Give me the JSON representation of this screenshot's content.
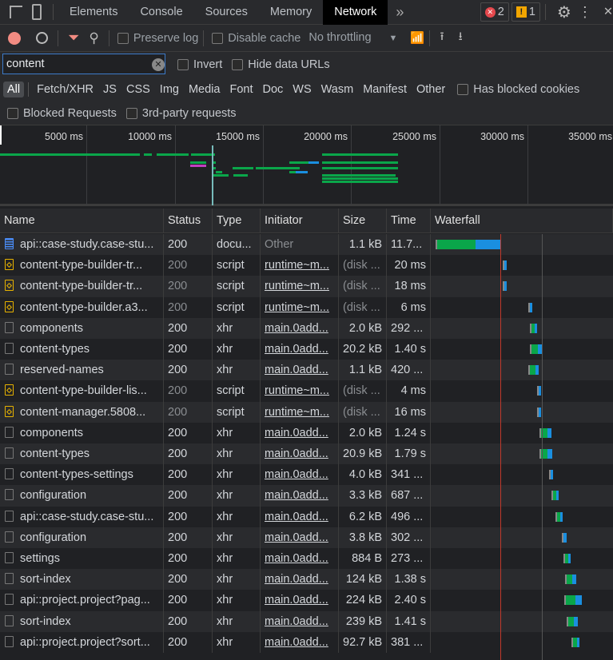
{
  "tabs": {
    "items": [
      "Elements",
      "Console",
      "Sources",
      "Memory",
      "Network"
    ],
    "active": "Network",
    "more": "»",
    "errors": "2",
    "warnings": "1"
  },
  "toolbar": {
    "preserve_log": "Preserve log",
    "disable_cache": "Disable cache",
    "throttling": "No throttling"
  },
  "filter": {
    "value": "content",
    "invert": "Invert",
    "hide_data_urls": "Hide data URLs"
  },
  "types": [
    "All",
    "Fetch/XHR",
    "JS",
    "CSS",
    "Img",
    "Media",
    "Font",
    "Doc",
    "WS",
    "Wasm",
    "Manifest",
    "Other"
  ],
  "has_blocked_cookies": "Has blocked cookies",
  "blocked_requests": "Blocked Requests",
  "third_party": "3rd-party requests",
  "overview": {
    "ticks": [
      "5000 ms",
      "10000 ms",
      "15000 ms",
      "20000 ms",
      "25000 ms",
      "30000 ms",
      "35000 ms"
    ]
  },
  "columns": [
    "Name",
    "Status",
    "Type",
    "Initiator",
    "Size",
    "Time",
    "Waterfall"
  ],
  "rows": [
    {
      "name": "api::case-study.case-stu...",
      "icon": "doc",
      "status": "200",
      "type": "docu...",
      "initiator": "Other",
      "size": "1.1 kB",
      "time": "11.7..."
    },
    {
      "name": "content-type-builder-tr...",
      "icon": "script",
      "status": "200",
      "type": "script",
      "initiator": "runtime~m...",
      "size": "(disk ...",
      "time": "20 ms"
    },
    {
      "name": "content-type-builder-tr...",
      "icon": "script",
      "status": "200",
      "type": "script",
      "initiator": "runtime~m...",
      "size": "(disk ...",
      "time": "18 ms"
    },
    {
      "name": "content-type-builder.a3...",
      "icon": "script",
      "status": "200",
      "type": "script",
      "initiator": "runtime~m...",
      "size": "(disk ...",
      "time": "6 ms"
    },
    {
      "name": "components",
      "icon": "xhr",
      "status": "200",
      "type": "xhr",
      "initiator": "main.0add...",
      "size": "2.0 kB",
      "time": "292 ..."
    },
    {
      "name": "content-types",
      "icon": "xhr",
      "status": "200",
      "type": "xhr",
      "initiator": "main.0add...",
      "size": "20.2 kB",
      "time": "1.40 s"
    },
    {
      "name": "reserved-names",
      "icon": "xhr",
      "status": "200",
      "type": "xhr",
      "initiator": "main.0add...",
      "size": "1.1 kB",
      "time": "420 ..."
    },
    {
      "name": "content-type-builder-lis...",
      "icon": "script",
      "status": "200",
      "type": "script",
      "initiator": "runtime~m...",
      "size": "(disk ...",
      "time": "4 ms"
    },
    {
      "name": "content-manager.5808...",
      "icon": "script",
      "status": "200",
      "type": "script",
      "initiator": "runtime~m...",
      "size": "(disk ...",
      "time": "16 ms"
    },
    {
      "name": "components",
      "icon": "xhr",
      "status": "200",
      "type": "xhr",
      "initiator": "main.0add...",
      "size": "2.0 kB",
      "time": "1.24 s"
    },
    {
      "name": "content-types",
      "icon": "xhr",
      "status": "200",
      "type": "xhr",
      "initiator": "main.0add...",
      "size": "20.9 kB",
      "time": "1.79 s"
    },
    {
      "name": "content-types-settings",
      "icon": "xhr",
      "status": "200",
      "type": "xhr",
      "initiator": "main.0add...",
      "size": "4.0 kB",
      "time": "341 ..."
    },
    {
      "name": "configuration",
      "icon": "xhr",
      "status": "200",
      "type": "xhr",
      "initiator": "main.0add...",
      "size": "3.3 kB",
      "time": "687 ..."
    },
    {
      "name": "api::case-study.case-stu...",
      "icon": "xhr",
      "status": "200",
      "type": "xhr",
      "initiator": "main.0add...",
      "size": "6.2 kB",
      "time": "496 ..."
    },
    {
      "name": "configuration",
      "icon": "xhr",
      "status": "200",
      "type": "xhr",
      "initiator": "main.0add...",
      "size": "3.8 kB",
      "time": "302 ..."
    },
    {
      "name": "settings",
      "icon": "xhr",
      "status": "200",
      "type": "xhr",
      "initiator": "main.0add...",
      "size": "884 B",
      "time": "273 ..."
    },
    {
      "name": "sort-index",
      "icon": "xhr",
      "status": "200",
      "type": "xhr",
      "initiator": "main.0add...",
      "size": "124 kB",
      "time": "1.38 s"
    },
    {
      "name": "api::project.project?pag...",
      "icon": "xhr",
      "status": "200",
      "type": "xhr",
      "initiator": "main.0add...",
      "size": "224 kB",
      "time": "2.40 s"
    },
    {
      "name": "sort-index",
      "icon": "xhr",
      "status": "200",
      "type": "xhr",
      "initiator": "main.0add...",
      "size": "239 kB",
      "time": "1.41 s"
    },
    {
      "name": "api::project.project?sort...",
      "icon": "xhr",
      "status": "200",
      "type": "xhr",
      "initiator": "main.0add...",
      "size": "92.7 kB",
      "time": "381 ..."
    }
  ],
  "colors": {
    "green": "#0aa64a",
    "blue": "#1a8fe0",
    "record": "#f28b82",
    "load_line": "#c0392b"
  }
}
